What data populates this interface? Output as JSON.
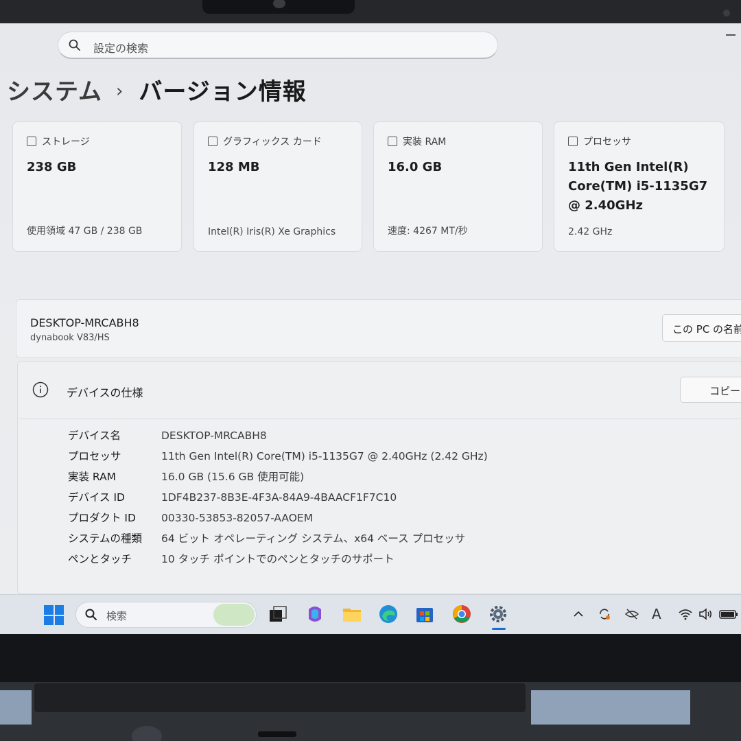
{
  "settings": {
    "search_placeholder": "設定の検索",
    "breadcrumb_parent": "システム",
    "page_title": "バージョン情報"
  },
  "cards": [
    {
      "label": "ストレージ",
      "value": "238 GB",
      "sub": "使用領域 47 GB / 238 GB",
      "icon": "storage-icon"
    },
    {
      "label": "グラフィックス カード",
      "value": "128 MB",
      "sub": "Intel(R) Iris(R) Xe Graphics",
      "icon": "graphics-card-icon"
    },
    {
      "label": "実装 RAM",
      "value": "16.0 GB",
      "sub": "速度: 4267 MT/秒",
      "icon": "ram-icon"
    },
    {
      "label": "プロセッサ",
      "value": "11th Gen Intel(R) Core(TM) i5-1135G7 @ 2.40GHz",
      "sub": "2.42 GHz",
      "icon": "processor-icon"
    }
  ],
  "pc": {
    "name": "DESKTOP-MRCABH8",
    "model": "dynabook V83/HS",
    "rename_label": "この PC の名前"
  },
  "specs": {
    "title": "デバイスの仕様",
    "copy_label": "コピー",
    "rows": [
      {
        "key": "デバイス名",
        "value": "DESKTOP-MRCABH8"
      },
      {
        "key": "プロセッサ",
        "value": "11th Gen Intel(R) Core(TM) i5-1135G7 @ 2.40GHz (2.42 GHz)"
      },
      {
        "key": "実装 RAM",
        "value": "16.0 GB (15.6 GB 使用可能)"
      },
      {
        "key": "デバイス ID",
        "value": "1DF4B237-8B3E-4F3A-84A9-4BAACF1F7C10"
      },
      {
        "key": "プロダクト ID",
        "value": "00330-53853-82057-AAOEM"
      },
      {
        "key": "システムの種類",
        "value": "64 ビット オペレーティング システム、x64 ベース プロセッサ"
      },
      {
        "key": "ペンとタッチ",
        "value": "10 タッチ ポイントでのペンとタッチのサポート"
      }
    ]
  },
  "taskbar": {
    "search_placeholder": "検索",
    "apps": [
      "task-view-icon",
      "m365-copilot-icon",
      "file-explorer-icon",
      "edge-icon",
      "microsoft-store-icon",
      "chrome-icon",
      "settings-icon"
    ],
    "tray": [
      "chevron-up-icon",
      "sync-icon",
      "eye-off-icon",
      "ime-indicator",
      "wifi-icon",
      "speaker-icon",
      "battery-icon"
    ],
    "ime_label": "A",
    "accent": "#1a6ed8"
  }
}
